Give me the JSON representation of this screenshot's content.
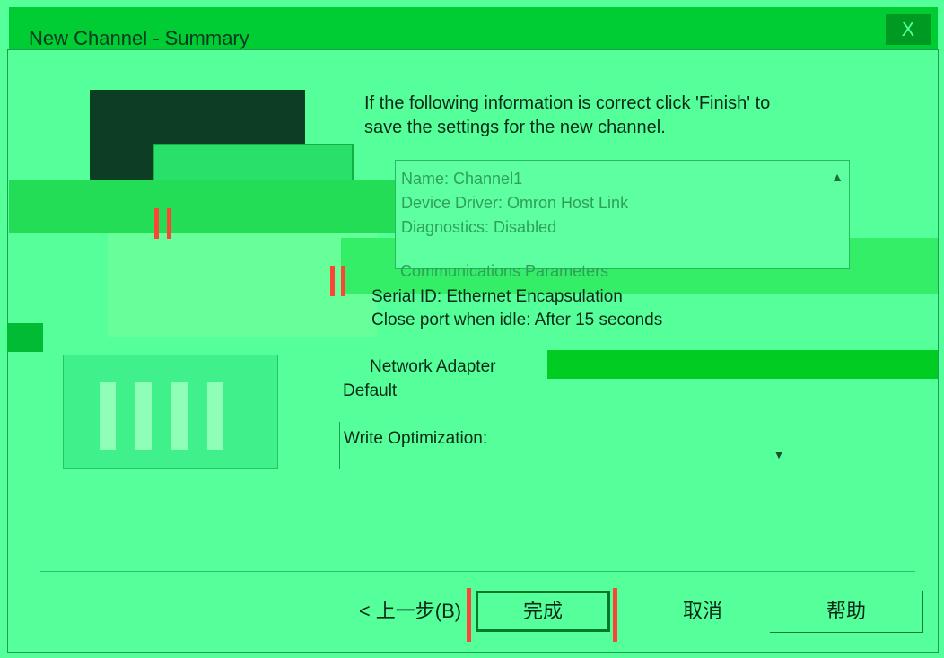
{
  "window": {
    "title": "New Channel - Summary",
    "close_glyph": "X"
  },
  "instruction": {
    "line1": "If the following information is correct click 'Finish' to",
    "line2": "save the settings for the new channel."
  },
  "summary": {
    "name": "Name: Channel1",
    "driver": "Device Driver: Omron Host Link",
    "diagnostics": "Diagnostics: Disabled",
    "comm_header": "Communications Parameters",
    "serial_id": "Serial ID: Ethernet Encapsulation",
    "close_port": "Close port when idle:  After 15 seconds",
    "network_adapter": "Network Adapter",
    "default": "Default",
    "write_optimization": "Write Optimization:"
  },
  "buttons": {
    "back": "< 上一步(B)",
    "finish": "完成",
    "cancel": "取消",
    "help": "帮助"
  },
  "colors": {
    "background": "#55ff99",
    "titlebar": "#00cc33",
    "accent": "#007a28"
  }
}
